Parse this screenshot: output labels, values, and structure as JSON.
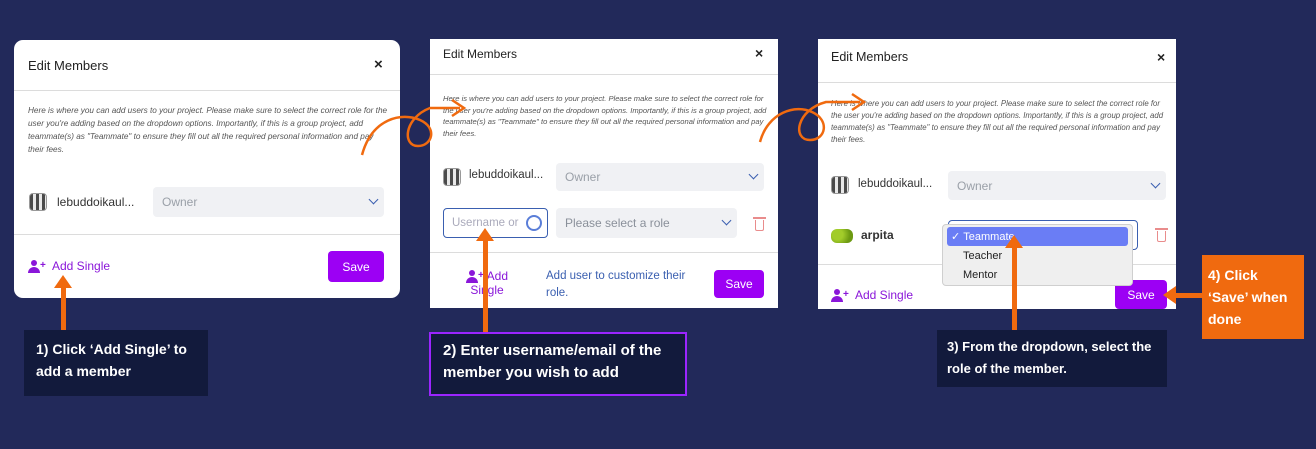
{
  "modal": {
    "title": "Edit Members",
    "close": "×",
    "description": "Here is where you can add users to your project. Please make sure to select the correct role for the user you're adding based on the dropdown options. Importantly, if this is a group project, add teammate(s) as \"Teammate\" to ensure they fill out all the required personal information and pay their fees.",
    "owner_username": "lebuddoikaul...",
    "owner_role": "Owner",
    "add_single": "Add Single",
    "save": "Save",
    "username_placeholder": "Username or",
    "role_placeholder": "Please select a role",
    "customize_hint": "Add user to customize their role.",
    "new_member": "arpita",
    "role_options": [
      "Teammate",
      "Teacher",
      "Mentor"
    ],
    "selected_role": "Teammate"
  },
  "callouts": {
    "step1": "1) Click ‘Add Single’ to add a member",
    "step2": "2) Enter username/email of the member you wish to add",
    "step3": "3) From the dropdown, select the role of the member.",
    "step4": "4) Click ‘Save’ when done"
  },
  "colors": {
    "background": "#22295a",
    "accent_purple": "#9c00f4",
    "arrow_orange": "#f06a0f",
    "callout_dark": "#121a3c"
  }
}
